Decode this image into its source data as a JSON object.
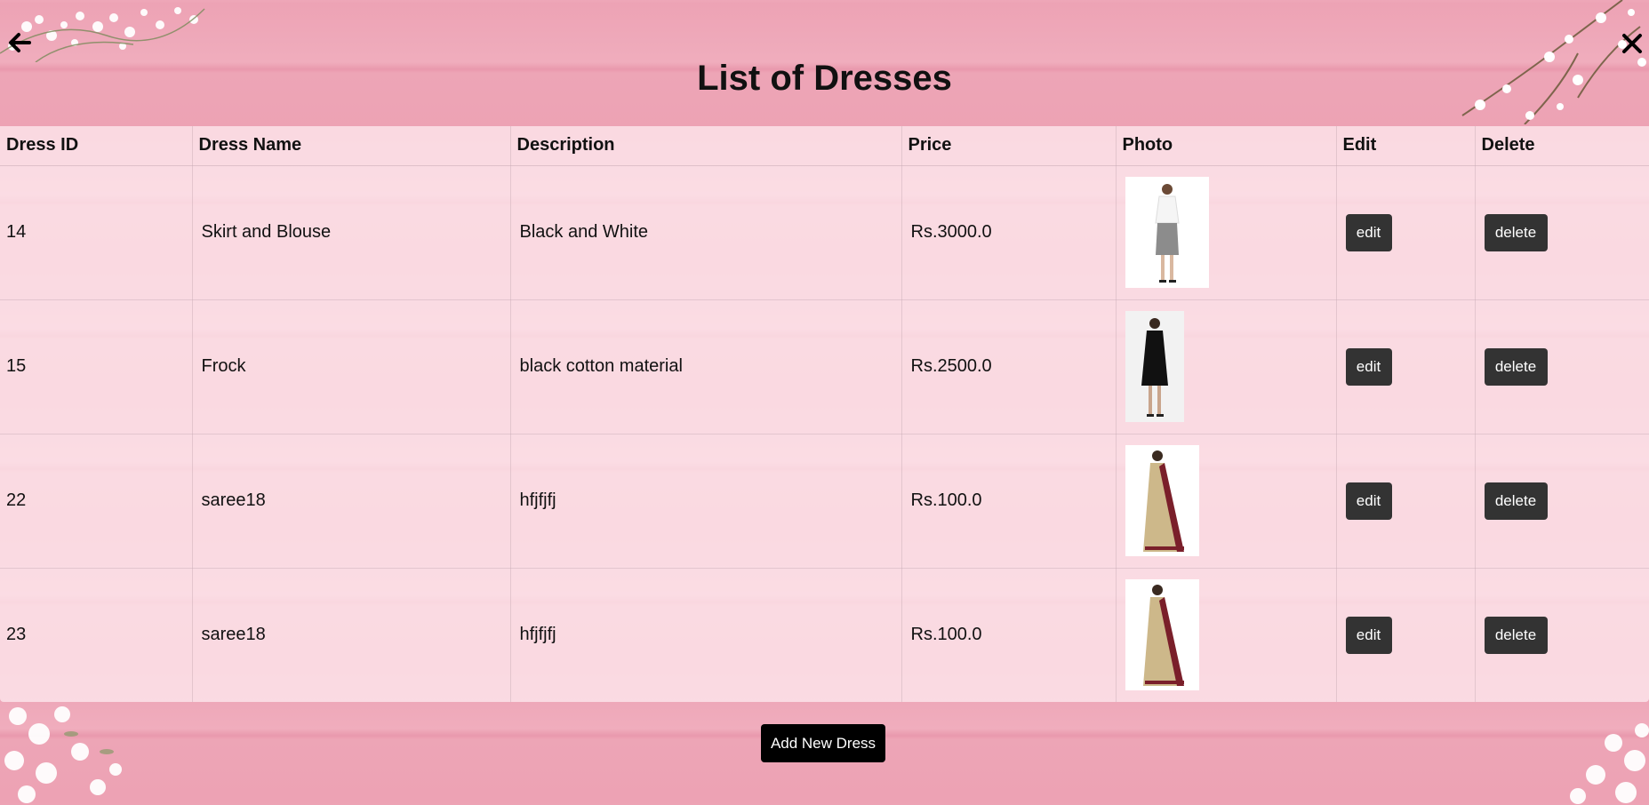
{
  "page": {
    "title": "List of Dresses",
    "add_button_label": "Add New Dress"
  },
  "nav": {
    "back_icon": "arrow-left-icon",
    "close_icon": "close-icon"
  },
  "table": {
    "columns": [
      "Dress ID",
      "Dress Name",
      "Description",
      "Price",
      "Photo",
      "Edit",
      "Delete"
    ],
    "rows": [
      {
        "id": "14",
        "name": "Skirt and Blouse",
        "description": "Black and White",
        "price": "Rs.3000.0",
        "photo": "woman in white blouse and grey pencil skirt",
        "edit_label": "edit",
        "delete_label": "delete"
      },
      {
        "id": "15",
        "name": "Frock",
        "description": "black cotton material",
        "price": "Rs.2500.0",
        "photo": "woman in black frock",
        "edit_label": "edit",
        "delete_label": "delete"
      },
      {
        "id": "22",
        "name": "saree18",
        "description": "hfjfjfj",
        "price": "Rs.100.0",
        "photo": "woman in beige and maroon saree",
        "edit_label": "edit",
        "delete_label": "delete"
      },
      {
        "id": "23",
        "name": "saree18",
        "description": "hfjfjfj",
        "price": "Rs.100.0",
        "photo": "woman in beige and maroon saree",
        "edit_label": "edit",
        "delete_label": "delete"
      }
    ]
  },
  "colors": {
    "background": "#eea4b6",
    "table_overlay": "#ffeef3",
    "button_dark": "#333333",
    "add_button": "#000000"
  }
}
